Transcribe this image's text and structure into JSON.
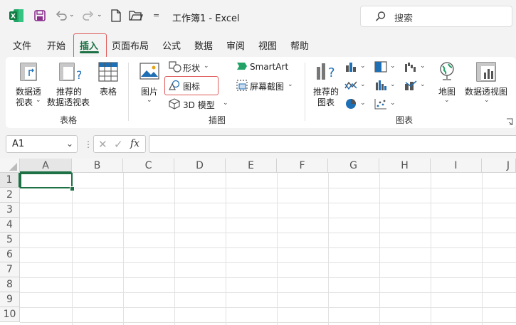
{
  "titlebar": {
    "title": "工作簿1  -  Excel",
    "search_placeholder": "搜索",
    "qat_more": "="
  },
  "menu": {
    "tabs": [
      "文件",
      "开始",
      "插入",
      "页面布局",
      "公式",
      "数据",
      "审阅",
      "视图",
      "帮助"
    ],
    "active": "插入"
  },
  "ribbon": {
    "tables": {
      "pivot1": "数据透",
      "pivot2": "视表",
      "rec1": "推荐的",
      "rec2": "数据透视表",
      "table": "表格",
      "group": "表格"
    },
    "illustrations": {
      "pictures": "图片",
      "shapes": "形状",
      "icons": "图标",
      "model3d": "3D 模型",
      "smartart": "SmartArt",
      "screenshot": "屏幕截图",
      "group": "插图"
    },
    "charts": {
      "recommended1": "推荐的",
      "recommended2": "图表",
      "map": "地图",
      "pivotchart": "数据透视图",
      "group": "图表"
    }
  },
  "formulabar": {
    "namebox": "A1",
    "fx": "fx",
    "value": ""
  },
  "sheet": {
    "columns": [
      "A",
      "B",
      "C",
      "D",
      "E",
      "F",
      "G",
      "H",
      "I",
      "J"
    ],
    "rows": [
      "1",
      "2",
      "3",
      "4",
      "5",
      "6",
      "7",
      "8",
      "9",
      "10"
    ],
    "selected_cell": "A1"
  },
  "colors": {
    "excel_green": "#1e7145",
    "highlight_red": "#e05a5a"
  }
}
